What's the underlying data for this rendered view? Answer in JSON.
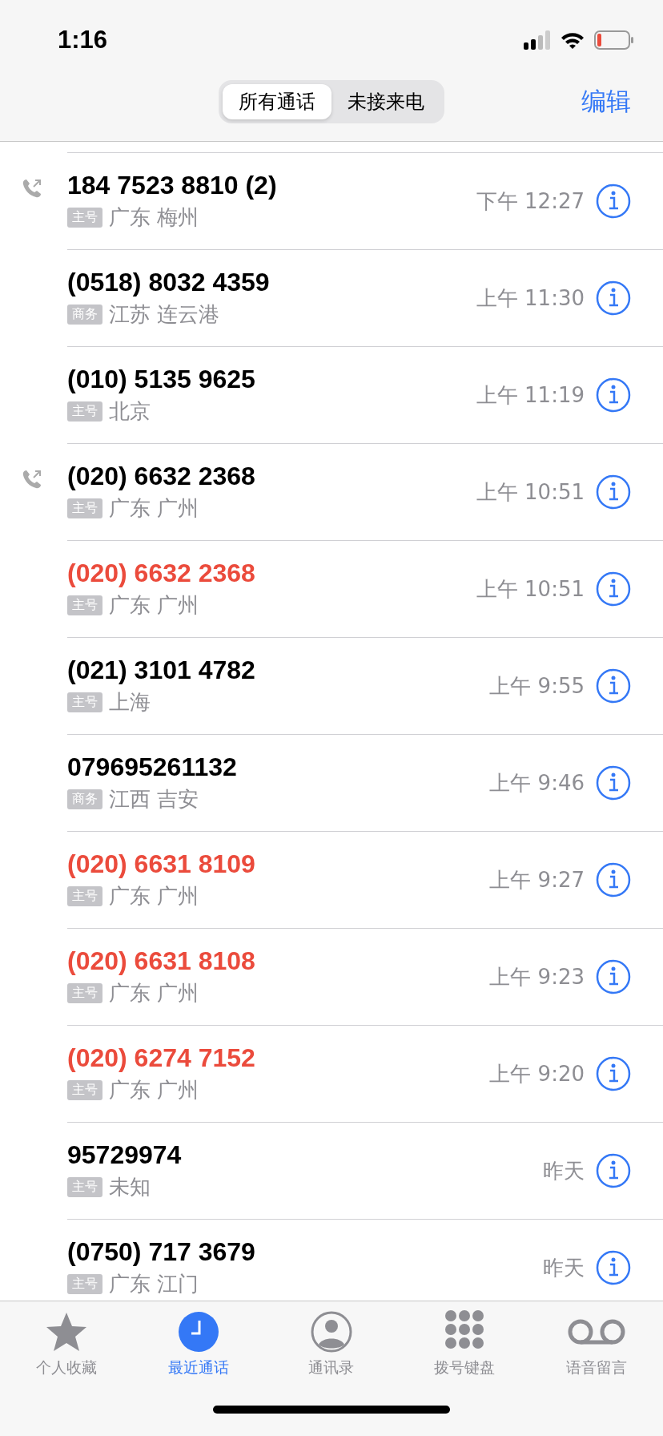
{
  "status_bar": {
    "time": "1:16"
  },
  "segments": [
    {
      "label": "所有通话",
      "selected": true
    },
    {
      "label": "未接来电",
      "selected": false
    }
  ],
  "edit_button": "编辑",
  "calls": [
    {
      "number": "184 7523 8810 (2)",
      "missed": false,
      "outgoing": true,
      "tag": "主号",
      "location": "广东 梅州",
      "time": "下午 12:27"
    },
    {
      "number": "(0518) 8032 4359",
      "missed": false,
      "outgoing": false,
      "tag": "商务",
      "location": "江苏 连云港",
      "time": "上午 11:30"
    },
    {
      "number": "(010) 5135 9625",
      "missed": false,
      "outgoing": false,
      "tag": "主号",
      "location": "北京",
      "time": "上午 11:19"
    },
    {
      "number": "(020) 6632 2368",
      "missed": false,
      "outgoing": true,
      "tag": "主号",
      "location": "广东 广州",
      "time": "上午 10:51"
    },
    {
      "number": "(020) 6632 2368",
      "missed": true,
      "outgoing": false,
      "tag": "主号",
      "location": "广东 广州",
      "time": "上午 10:51"
    },
    {
      "number": "(021) 3101 4782",
      "missed": false,
      "outgoing": false,
      "tag": "主号",
      "location": "上海",
      "time": "上午 9:55"
    },
    {
      "number": "079695261132",
      "missed": false,
      "outgoing": false,
      "tag": "商务",
      "location": "江西 吉安",
      "time": "上午 9:46"
    },
    {
      "number": "(020) 6631 8109",
      "missed": true,
      "outgoing": false,
      "tag": "主号",
      "location": "广东 广州",
      "time": "上午 9:27"
    },
    {
      "number": "(020) 6631 8108",
      "missed": true,
      "outgoing": false,
      "tag": "主号",
      "location": "广东 广州",
      "time": "上午 9:23"
    },
    {
      "number": "(020) 6274 7152",
      "missed": true,
      "outgoing": false,
      "tag": "主号",
      "location": "广东 广州",
      "time": "上午 9:20"
    },
    {
      "number": "95729974",
      "missed": false,
      "outgoing": false,
      "tag": "主号",
      "location": "未知",
      "time": "昨天"
    },
    {
      "number": "(0750) 717 3679",
      "missed": false,
      "outgoing": false,
      "tag": "主号",
      "location": "广东 江门",
      "time": "昨天"
    }
  ],
  "tab_bar": [
    {
      "kind": "favorites",
      "label": "个人收藏",
      "selected": false
    },
    {
      "kind": "recents",
      "label": "最近通话",
      "selected": true
    },
    {
      "kind": "contacts",
      "label": "通讯录",
      "selected": false
    },
    {
      "kind": "keypad",
      "label": "拨号键盘",
      "selected": false
    },
    {
      "kind": "voicemail",
      "label": "语音留言",
      "selected": false
    }
  ]
}
